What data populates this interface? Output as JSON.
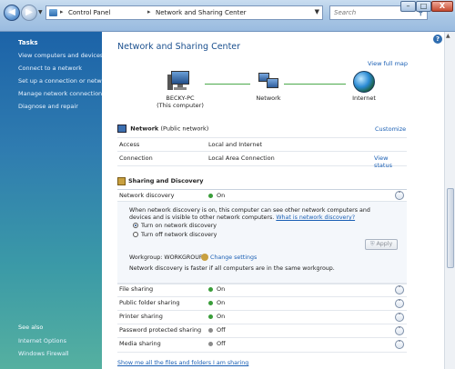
{
  "window": {
    "address": {
      "crumbs": [
        "Control Panel",
        "Network and Sharing Center"
      ],
      "separator": "▸"
    },
    "search": {
      "placeholder": "Search"
    },
    "controls": {
      "minimize": "–",
      "maximize": "□",
      "close": "X"
    }
  },
  "sidebar": {
    "tasks_title": "Tasks",
    "tasks": [
      "View computers and devices",
      "Connect to a network",
      "Set up a connection or network",
      "Manage network connections",
      "Diagnose and repair"
    ],
    "see_also_title": "See also",
    "see_also": [
      "Internet Options",
      "Windows Firewall"
    ]
  },
  "main": {
    "title": "Network and Sharing Center",
    "view_full_map": "View full map",
    "map": {
      "pc_name": "BECKY-PC",
      "pc_sub": "(This computer)",
      "network": "Network",
      "internet": "Internet"
    },
    "network": {
      "title": "Network",
      "title_sub": "(Public network)",
      "customize": "Customize",
      "rows": [
        {
          "key": "Access",
          "value": "Local and Internet",
          "link": ""
        },
        {
          "key": "Connection",
          "value": "Local Area Connection",
          "link": "View status"
        }
      ]
    },
    "sharing": {
      "title": "Sharing and Discovery",
      "network_discovery": {
        "label": "Network discovery",
        "status": "On",
        "desc": "When network discovery is on, this computer can see other network computers and devices and is visible to other network computers.",
        "desc_link": "What is network discovery?",
        "radio_on": "Turn on network discovery",
        "radio_off": "Turn off network discovery",
        "apply": "Apply",
        "workgroup": "Workgroup: WORKGROUP",
        "change_settings": "Change settings",
        "footer": "Network discovery is faster if all computers are in the same workgroup."
      },
      "rows": [
        {
          "label": "File sharing",
          "status": "On"
        },
        {
          "label": "Public folder sharing",
          "status": "On"
        },
        {
          "label": "Printer sharing",
          "status": "On"
        },
        {
          "label": "Password protected sharing",
          "status": "Off"
        },
        {
          "label": "Media sharing",
          "status": "Off"
        }
      ],
      "show_all": "Show me all the files and folders I am sharing"
    }
  },
  "colors": {
    "link": "#1a5fb4",
    "status_on": "#3a9d3a",
    "status_off": "#8a8a8a",
    "title": "#1a4f8e"
  }
}
